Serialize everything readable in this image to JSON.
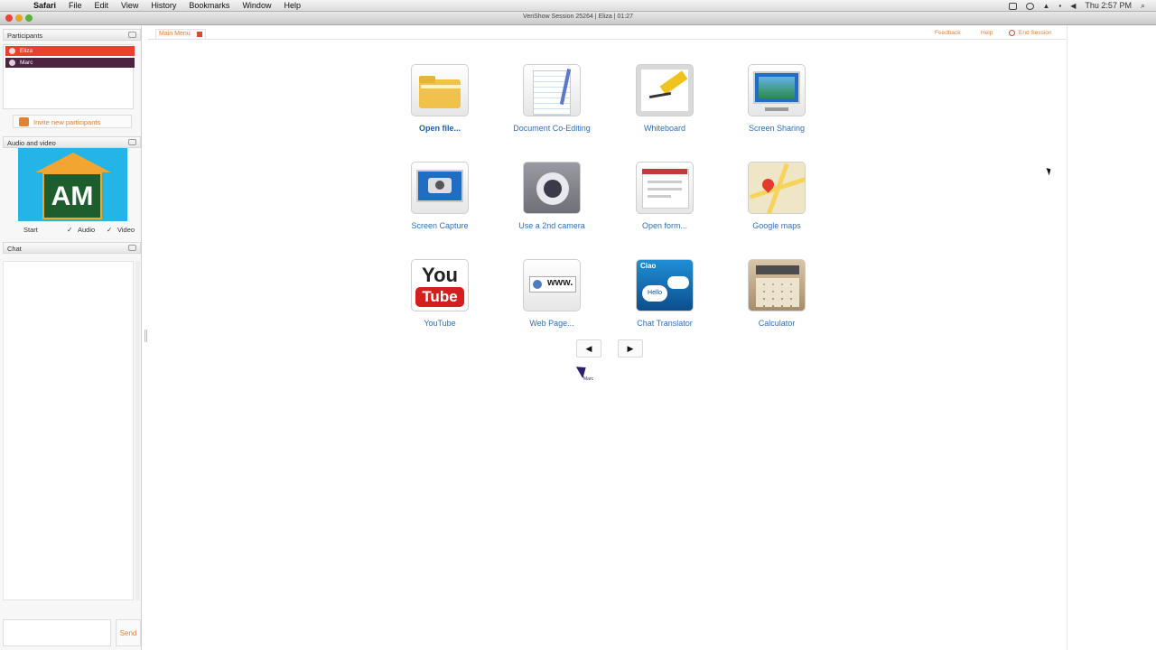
{
  "menubar": {
    "app": "Safari",
    "menus": [
      "File",
      "Edit",
      "View",
      "History",
      "Bookmarks",
      "Window",
      "Help"
    ],
    "clock": "Thu 2:57 PM"
  },
  "window": {
    "title": "VeriShow Session 25264 | Eliza | 01:27"
  },
  "sidebar": {
    "participants_label": "Participants",
    "participants": [
      "Eliza",
      "Marc"
    ],
    "invite_label": "Invite new participants",
    "audio_video_label": "Audio and video",
    "video_initials": "AM",
    "start_label": "Start",
    "audio_label": "Audio",
    "video_label": "Video",
    "chat_label": "Chat",
    "send_label": "Send"
  },
  "main": {
    "breadcrumb": "Main Menu",
    "feedback_label": "Feedback",
    "help_label": "Help",
    "end_session_label": "End Session",
    "tiles": [
      {
        "label": "Open file...",
        "icon": "folder-icon"
      },
      {
        "label": "Document Co-Editing",
        "icon": "notepad-icon"
      },
      {
        "label": "Whiteboard",
        "icon": "whiteboard-icon"
      },
      {
        "label": "Screen Sharing",
        "icon": "monitor-icon"
      },
      {
        "label": "Screen Capture",
        "icon": "camera-capture-icon"
      },
      {
        "label": "Use a 2nd camera",
        "icon": "webcam-icon"
      },
      {
        "label": "Open form...",
        "icon": "form-icon"
      },
      {
        "label": "Google maps",
        "icon": "map-icon"
      },
      {
        "label": "YouTube",
        "icon": "youtube-icon"
      },
      {
        "label": "Web Page...",
        "icon": "web-page-icon"
      },
      {
        "label": "Chat Translator",
        "icon": "translator-icon"
      },
      {
        "label": "Calculator",
        "icon": "calculator-icon"
      }
    ],
    "youtube_you": "You",
    "youtube_tube": "Tube",
    "www_text": "www.",
    "translator_words": [
      "Ciao",
      "Hello"
    ],
    "prev_symbol": "◀",
    "next_symbol": "▶",
    "cursor_tag": "Marc"
  }
}
